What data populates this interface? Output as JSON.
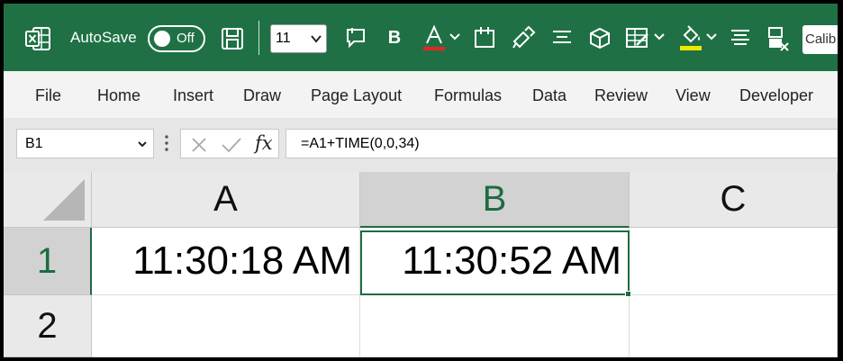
{
  "titlebar": {
    "autosave_label": "AutoSave",
    "autosave_state": "Off",
    "font_size": "11",
    "font_name": "Calib",
    "icons": [
      "excel-logo-icon",
      "save-icon",
      "chevron-down-icon",
      "comment-icon",
      "bold-icon",
      "font-color-icon",
      "borders-icon",
      "format-painter-icon",
      "align-center-icon",
      "package-icon",
      "conditional-format-icon",
      "fill-color-icon",
      "align-icon",
      "clear-format-icon"
    ],
    "font_color_underline": "#e52521",
    "fill_color_underline": "#f3e600"
  },
  "menu": {
    "items": [
      "File",
      "Home",
      "Insert",
      "Draw",
      "Page Layout",
      "Formulas",
      "Data",
      "Review",
      "View",
      "Developer"
    ]
  },
  "formula_bar": {
    "name_box": "B1",
    "fx_label": "fx",
    "formula": "=A1+TIME(0,0,34)"
  },
  "grid": {
    "columns": [
      "A",
      "B",
      "C"
    ],
    "rows": [
      "1",
      "2"
    ],
    "cells": {
      "A1": "11:30:18 AM",
      "B1": "11:30:52 AM",
      "C1": "",
      "A2": "",
      "B2": "",
      "C2": ""
    },
    "active_cell": "B1"
  },
  "colors": {
    "ribbon_green": "#1f7145",
    "accent_green": "#1e6b41"
  }
}
